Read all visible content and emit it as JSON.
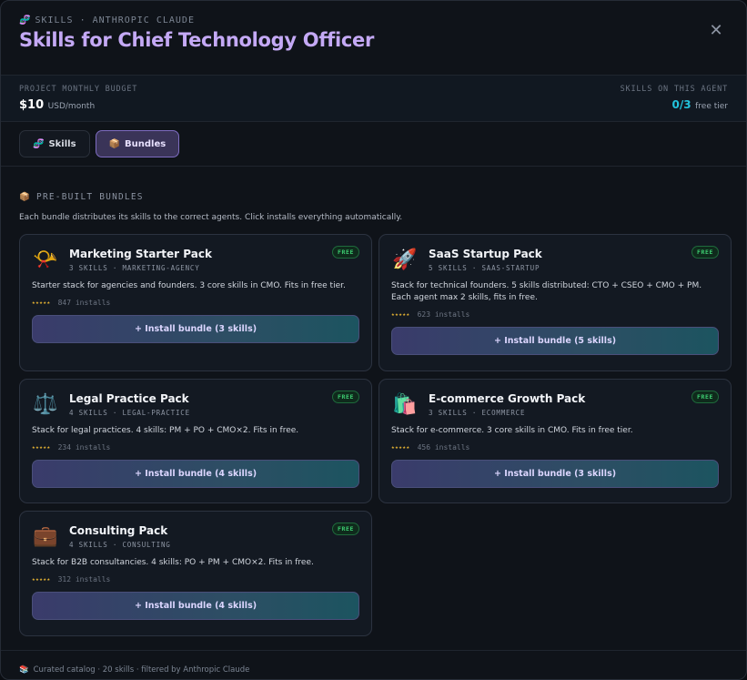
{
  "header": {
    "eyebrow_icon": "🧬",
    "eyebrow": "SKILLS · ANTHROPIC CLAUDE",
    "title": "Skills for Chief Technology Officer",
    "close_icon": "✕"
  },
  "budget": {
    "label": "PROJECT MONTHLY BUDGET",
    "amount": "$10",
    "unit": "USD/month",
    "skills_label": "SKILLS ON THIS AGENT",
    "skills_count": "0/3",
    "skills_tier": "free tier"
  },
  "tabs": [
    {
      "icon": "🧬",
      "label": "Skills",
      "active": false
    },
    {
      "icon": "📦",
      "label": "Bundles",
      "active": true
    }
  ],
  "section": {
    "icon": "📦",
    "title": "PRE-BUILT BUNDLES",
    "description": "Each bundle distributes its skills to the correct agents. Click installs everything automatically."
  },
  "bundles": [
    {
      "icon": "📯",
      "name": "Marketing Starter Pack",
      "meta": "3 SKILLS · MARKETING-AGENCY",
      "badge": "FREE",
      "description": "Starter stack for agencies and founders. 3 core skills in CMO. Fits in free tier.",
      "stars": "★★★★★",
      "installs": "847 installs",
      "button": "+ Install bundle (3 skills)"
    },
    {
      "icon": "🚀",
      "name": "SaaS Startup Pack",
      "meta": "5 SKILLS · SAAS-STARTUP",
      "badge": "FREE",
      "description": "Stack for technical founders. 5 skills distributed: CTO + CSEO + CMO + PM. Each agent max 2 skills, fits in free.",
      "stars": "★★★★★",
      "installs": "623 installs",
      "button": "+ Install bundle (5 skills)"
    },
    {
      "icon": "⚖️",
      "name": "Legal Practice Pack",
      "meta": "4 SKILLS · LEGAL-PRACTICE",
      "badge": "FREE",
      "description": "Stack for legal practices. 4 skills: PM + PO + CMO×2. Fits in free.",
      "stars": "★★★★★",
      "installs": "234 installs",
      "button": "+ Install bundle (4 skills)"
    },
    {
      "icon": "🛍️",
      "name": "E-commerce Growth Pack",
      "meta": "3 SKILLS · ECOMMERCE",
      "badge": "FREE",
      "description": "Stack for e-commerce. 3 core skills in CMO. Fits in free tier.",
      "stars": "★★★★★",
      "installs": "456 installs",
      "button": "+ Install bundle (3 skills)"
    },
    {
      "icon": "💼",
      "name": "Consulting Pack",
      "meta": "4 SKILLS · CONSULTING",
      "badge": "FREE",
      "description": "Stack for B2B consultancies. 4 skills: PO + PM + CMO×2. Fits in free.",
      "stars": "★★★★★",
      "installs": "312 installs",
      "button": "+ Install bundle (4 skills)"
    }
  ],
  "footer": {
    "icon": "📚",
    "text": "Curated catalog · 20 skills · filtered by Anthropic Claude"
  }
}
